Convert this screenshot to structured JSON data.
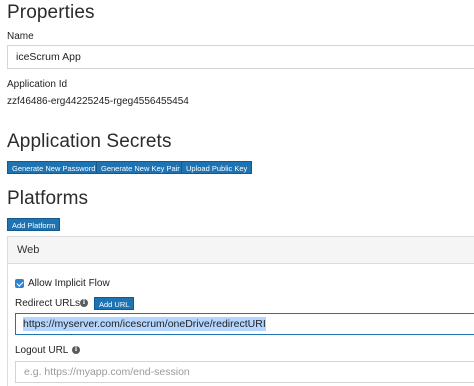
{
  "properties": {
    "heading": "Properties",
    "name_label": "Name",
    "name_value": "iceScrum App",
    "app_id_label": "Application Id",
    "app_id_value": "zzf46486-erg44225245-rgeg4556455454"
  },
  "secrets": {
    "heading": "Application Secrets",
    "buttons": {
      "generate_password": "Generate New Password",
      "generate_key_pair": "Generate New Key Pair",
      "upload_public_key": "Upload Public Key"
    }
  },
  "platforms": {
    "heading": "Platforms",
    "add_platform": "Add Platform",
    "web": {
      "title": "Web",
      "allow_implicit_flow_label": "Allow Implicit Flow",
      "allow_implicit_flow_checked": true,
      "redirect_urls_label": "Redirect URLs",
      "add_url_button": "Add URL",
      "redirect_url_value": "https://myserver.com/icescrum/oneDrive/redirectURI",
      "logout_url_label": "Logout URL",
      "logout_url_placeholder": "e.g. https://myapp.com/end-session"
    }
  },
  "icons": {
    "info": "info-icon",
    "checkbox": "checkbox-checked-icon"
  },
  "colors": {
    "button_bg": "#1e73b3",
    "checkbox": "#2d83d1",
    "selection": "#b4d5fe",
    "active_input_border": "#1e73b3"
  }
}
